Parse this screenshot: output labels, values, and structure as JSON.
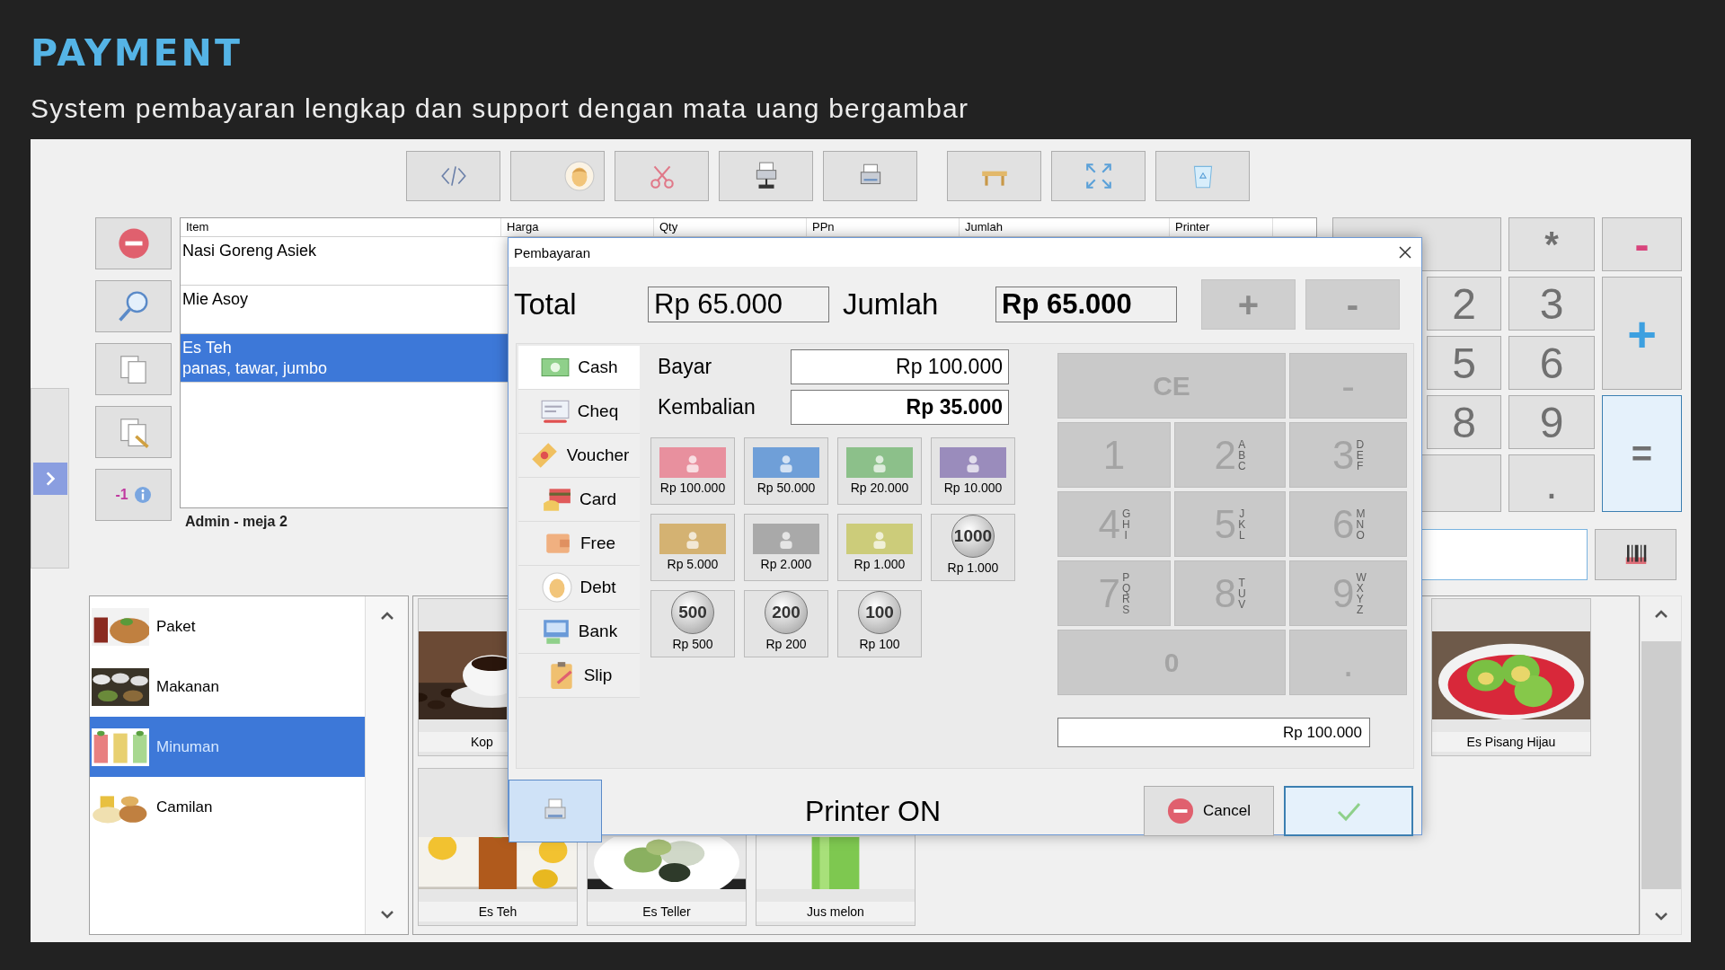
{
  "header": {
    "title": "PAYMENT",
    "subtitle": "System pembayaran lengkap dan support dengan mata uang bergambar"
  },
  "side_tools": {
    "counter": "-1"
  },
  "order": {
    "columns": [
      "Item",
      "Harga",
      "Qty",
      "PPn",
      "Jumlah",
      "Printer"
    ],
    "rows": [
      {
        "item": "Nasi Goreng Asiek",
        "selected": false
      },
      {
        "item": "Mie Asoy",
        "selected": false
      },
      {
        "item": "Es Teh",
        "note": "panas, tawar, jumbo",
        "selected": true
      }
    ],
    "footer": "Admin - meja 2"
  },
  "calculator": {
    "keys": [
      {
        "label": "*",
        "kind": "op",
        "focused": false
      },
      {
        "label": "-",
        "kind": "minus",
        "focused": false
      },
      {
        "label": "2",
        "kind": "digit",
        "focused": false
      },
      {
        "label": "3",
        "kind": "digit",
        "focused": false
      },
      {
        "label": "+",
        "kind": "plus",
        "focused": false
      },
      {
        "label": "5",
        "kind": "digit",
        "focused": false
      },
      {
        "label": "6",
        "kind": "digit",
        "focused": false
      },
      {
        "label": "8",
        "kind": "digit",
        "focused": false
      },
      {
        "label": "9",
        "kind": "digit",
        "focused": false
      },
      {
        "label": "=",
        "kind": "op",
        "focused": true
      },
      {
        "label": ".",
        "kind": "digit",
        "focused": false
      }
    ]
  },
  "categories": [
    {
      "label": "Paket",
      "selected": false
    },
    {
      "label": "Makanan",
      "selected": false
    },
    {
      "label": "Minuman",
      "selected": true
    },
    {
      "label": "Camilan",
      "selected": false
    }
  ],
  "products": [
    {
      "tiles": [
        {
          "label": "Kop"
        },
        {
          "label": "Es Pisang Hijau"
        }
      ]
    },
    {
      "tiles": [
        {
          "label": "Es Teh"
        },
        {
          "label": "Es Teller"
        },
        {
          "label": "Jus melon"
        }
      ]
    }
  ],
  "dialog": {
    "title": "Pembayaran",
    "total_label": "Total",
    "total": "Rp 65.000",
    "jumlah_label": "Jumlah",
    "jumlah": "Rp 65.000",
    "qty_buttons": [
      "+",
      "-"
    ],
    "methods": [
      {
        "label": "Cash",
        "selected": true
      },
      {
        "label": "Cheq",
        "selected": false
      },
      {
        "label": "Voucher",
        "selected": false
      },
      {
        "label": "Card",
        "selected": false
      },
      {
        "label": "Free",
        "selected": false
      },
      {
        "label": "Debt",
        "selected": false
      },
      {
        "label": "Bank",
        "selected": false
      },
      {
        "label": "Slip",
        "selected": false
      }
    ],
    "bayar_label": "Bayar",
    "bayar": "Rp 100.000",
    "kembalian_label": "Kembalian",
    "kembalian": "Rp 35.000",
    "money": [
      {
        "kind": "note",
        "color": "#e8909e",
        "label": "Rp 100.000"
      },
      {
        "kind": "note",
        "color": "#6f9fd8",
        "label": "Rp 50.000"
      },
      {
        "kind": "note",
        "color": "#8cc08a",
        "label": "Rp 20.000"
      },
      {
        "kind": "note",
        "color": "#9a8cbc",
        "label": "Rp 10.000"
      },
      {
        "kind": "note",
        "color": "#d4b272",
        "label": "Rp 5.000"
      },
      {
        "kind": "note",
        "color": "#a9a9a9",
        "label": "Rp 2.000"
      },
      {
        "kind": "note",
        "color": "#cccc7a",
        "label": "Rp 1.000"
      },
      {
        "kind": "coin",
        "face": "1000",
        "label": "Rp 1.000"
      },
      {
        "kind": "coin",
        "face": "500",
        "label": "Rp 500"
      },
      {
        "kind": "coin",
        "face": "200",
        "label": "Rp 200"
      },
      {
        "kind": "coin",
        "face": "100",
        "label": "Rp 100"
      }
    ],
    "keypad": [
      {
        "digit": "CE",
        "kind": "wide"
      },
      {
        "digit": "-",
        "kind": "key"
      },
      {
        "digit": "1",
        "kind": "key"
      },
      {
        "digit": "2",
        "letters": "ABC",
        "kind": "key"
      },
      {
        "digit": "3",
        "letters": "DEF",
        "kind": "key"
      },
      {
        "digit": "4",
        "letters": "GHI",
        "kind": "key"
      },
      {
        "digit": "5",
        "letters": "JKL",
        "kind": "key"
      },
      {
        "digit": "6",
        "letters": "MNO",
        "kind": "key"
      },
      {
        "digit": "7",
        "letters": "PQRS",
        "kind": "key"
      },
      {
        "digit": "8",
        "letters": "TUV",
        "kind": "key"
      },
      {
        "digit": "9",
        "letters": "WXYZ",
        "kind": "key"
      },
      {
        "digit": "0",
        "kind": "wide"
      },
      {
        "digit": ".",
        "kind": "key"
      }
    ],
    "amount": "Rp 100.000",
    "printer_status": "Printer ON",
    "cancel": "Cancel"
  }
}
